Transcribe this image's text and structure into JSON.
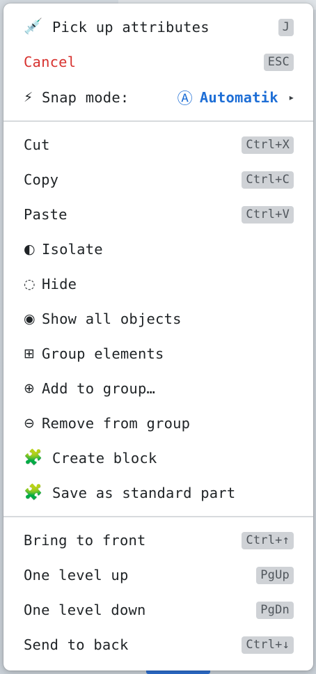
{
  "menu": {
    "top": {
      "pick_up": {
        "icon": "💉",
        "label": "Pick up attributes",
        "shortcut": "J"
      },
      "cancel": {
        "label": "Cancel",
        "shortcut": "ESC"
      },
      "snap": {
        "icon": "⚡",
        "label": "Snap mode:",
        "value_icon": "Ⓐ",
        "value": "Automatik",
        "arrow": "▸"
      }
    },
    "edit": {
      "cut": {
        "label": "Cut",
        "shortcut": "Ctrl+X"
      },
      "copy": {
        "label": "Copy",
        "shortcut": "Ctrl+C"
      },
      "paste": {
        "label": "Paste",
        "shortcut": "Ctrl+V"
      },
      "isolate": {
        "icon": "◐",
        "label": "Isolate"
      },
      "hide": {
        "icon": "◌",
        "label": "Hide"
      },
      "show_all": {
        "icon": "◉",
        "label": "Show all objects"
      },
      "group": {
        "icon": "⊞",
        "label": "Group elements"
      },
      "add_group": {
        "icon": "⊕",
        "label": "Add to group…"
      },
      "remove_group": {
        "icon": "⊖",
        "label": "Remove from group"
      },
      "create_block": {
        "icon": "🧩",
        "label": "Create block"
      },
      "save_standard": {
        "icon": "🧩",
        "label": "Save as standard part"
      }
    },
    "arrange": {
      "bring_front": {
        "label": "Bring to front",
        "shortcut": "Ctrl+↑"
      },
      "level_up": {
        "label": "One level up",
        "shortcut": "PgUp"
      },
      "level_down": {
        "label": "One level down",
        "shortcut": "PgDn"
      },
      "send_back": {
        "label": "Send to back",
        "shortcut": "Ctrl+↓"
      }
    }
  },
  "colors": {
    "danger": "#d7322f",
    "accent": "#1f6fd6",
    "kbd_bg": "#cfd2d6"
  }
}
